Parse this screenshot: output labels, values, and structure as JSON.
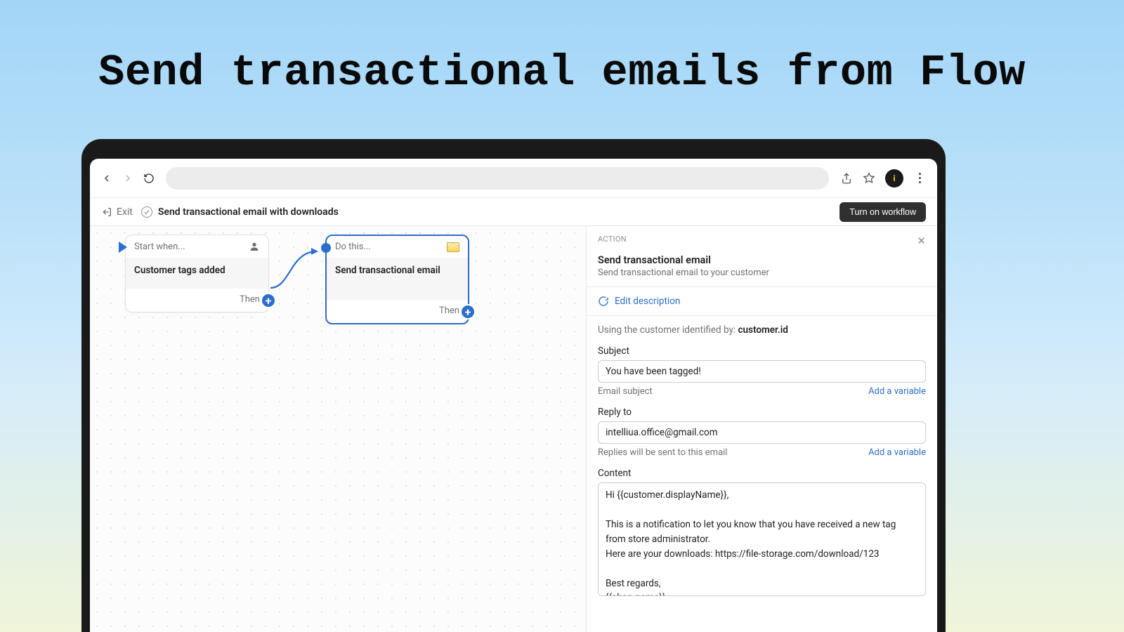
{
  "hero": {
    "title": "Send transactional emails from Flow"
  },
  "browser": {
    "back": "Back",
    "forward": "Forward",
    "reload": "Reload"
  },
  "appHeader": {
    "exit": "Exit",
    "workflowTitle": "Send transactional email with downloads",
    "turnOn": "Turn on workflow"
  },
  "canvas": {
    "trigger": {
      "headerLabel": "Start when...",
      "title": "Customer tags added",
      "then": "Then"
    },
    "action": {
      "headerLabel": "Do this...",
      "title": "Send transactional email",
      "then": "Then"
    }
  },
  "panel": {
    "sectionLabel": "ACTION",
    "title": "Send transactional email",
    "subtitle": "Send transactional email to your customer",
    "editDescription": "Edit description",
    "usingPrefix": "Using the customer identified by: ",
    "usingValue": "customer.id",
    "subject": {
      "label": "Subject",
      "value": "You have been tagged!",
      "help": "Email subject",
      "addVar": "Add a variable"
    },
    "replyTo": {
      "label": "Reply to",
      "value": "intelliua.office@gmail.com",
      "help": "Replies will be sent to this email",
      "addVar": "Add a variable"
    },
    "content": {
      "label": "Content",
      "value": "Hi {{customer.displayName}},\n\nThis is a notification to let you know that you have received a new tag from store administrator.\nHere are your downloads: https://file-storage.com/download/123\n\nBest regards,\n{{shop.name}}."
    }
  }
}
